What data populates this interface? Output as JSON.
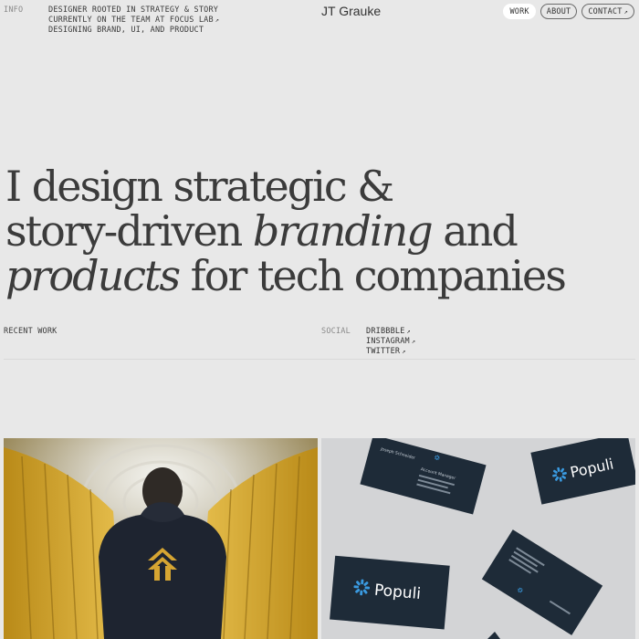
{
  "header": {
    "info_label": "INFO",
    "info_lines": [
      "DESIGNER ROOTED IN STRATEGY & STORY",
      "CURRENTLY ON THE TEAM AT FOCUS LAB",
      "DESIGNING BRAND, UI, AND PRODUCT"
    ],
    "brand": "JT Grauke",
    "nav": [
      "WORK",
      "ABOUT",
      "CONTACT"
    ]
  },
  "hero": {
    "line1": "I design strategic &",
    "line2_a": "story-driven ",
    "line2_em": "branding",
    "line2_b": " and",
    "line3_em": "products",
    "line3_b": " for tech companies"
  },
  "section": {
    "recent_label": "RECENT WORK",
    "social_label": "SOCIAL",
    "social_links": [
      "DRIBBBLE",
      "INSTAGRAM",
      "TWITTER"
    ]
  },
  "work": {
    "card_right_brand": "Populi",
    "card_small_name": "Joseph Schneider",
    "card_small_title": "Account Manager"
  },
  "icons": {
    "arrow": "north-east-arrow-icon",
    "logo": "populi-starburst-icon"
  },
  "colors": {
    "background": "#e8e8e8",
    "text": "#3a3a3a",
    "card_navy": "#1e2b38",
    "accent_yellow": "#e1b53a",
    "populi_blue": "#3a9ae0"
  }
}
